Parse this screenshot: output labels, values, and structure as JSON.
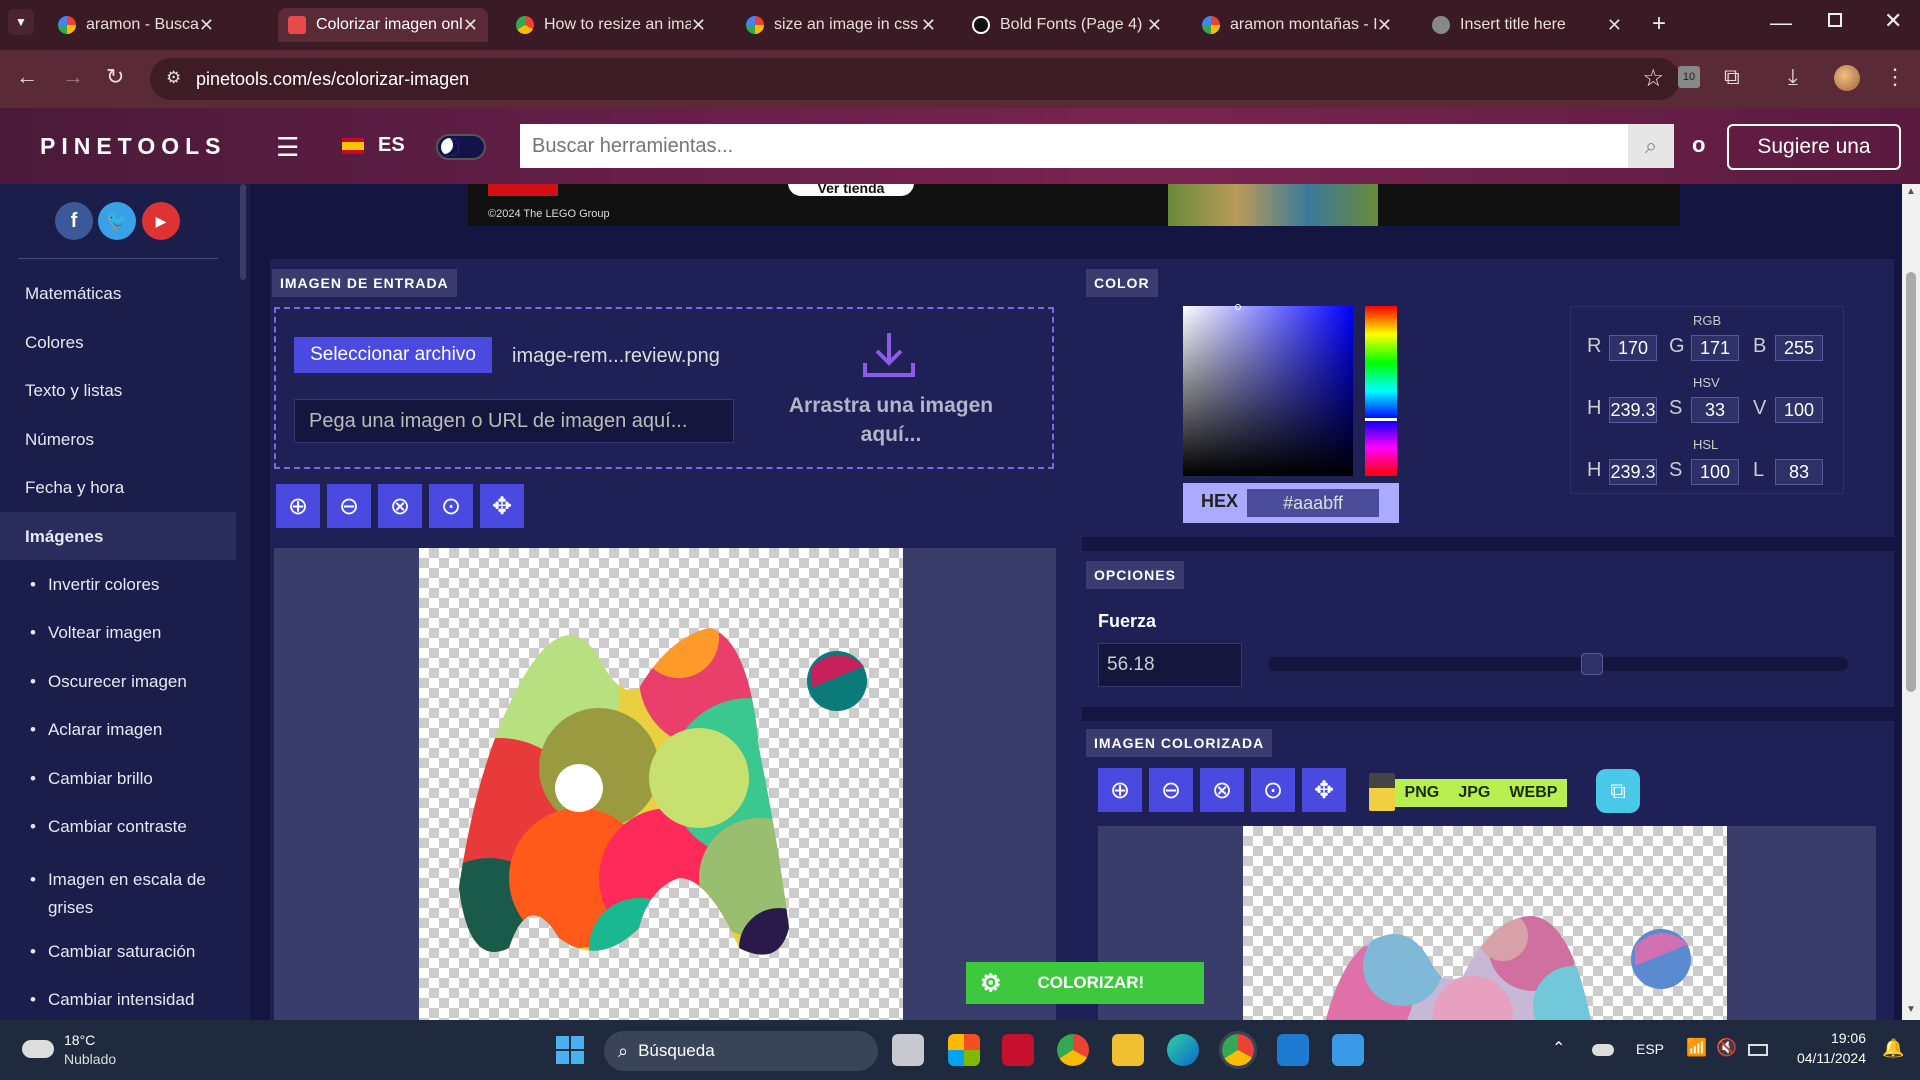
{
  "tabs": [
    {
      "title": "aramon - Buscar con",
      "favicon": "google-icon",
      "active": false
    },
    {
      "title": "Colorizar imagen onli",
      "favicon": "pinetools-icon",
      "active": true
    },
    {
      "title": "How to resize an ima",
      "favicon": "chrome-icon",
      "active": false
    },
    {
      "title": "size an image in css -",
      "favicon": "google-icon",
      "active": false
    },
    {
      "title": "Bold Fonts (Page 4) |",
      "favicon": "bird-icon",
      "active": false
    },
    {
      "title": "aramon montañas - I",
      "favicon": "google-icon",
      "active": false
    },
    {
      "title": "Insert title here",
      "favicon": "globe-icon",
      "active": false
    }
  ],
  "url": "pinetools.com/es/colorizar-imagen",
  "extension_badge": "10",
  "site": {
    "logo": "PINETOOLS",
    "lang": "ES",
    "search_placeholder": "Buscar herramientas...",
    "letter": "o",
    "suggest_label": "Sugiere una"
  },
  "ad": {
    "copyright": "©2024 The LEGO Group",
    "cta": "Ver tienda"
  },
  "sidebar": {
    "categories": [
      "Matemáticas",
      "Colores",
      "Texto y listas",
      "Números",
      "Fecha y hora",
      "Imágenes"
    ],
    "active": "Imágenes",
    "subitems": [
      "Invertir colores",
      "Voltear imagen",
      "Oscurecer imagen",
      "Aclarar imagen",
      "Cambiar brillo",
      "Cambiar contraste",
      "Imagen en escala de grises",
      "Cambiar saturación",
      "Cambiar intensidad"
    ]
  },
  "input_panel": {
    "title": "IMAGEN DE ENTRADA",
    "select_file": "Seleccionar archivo",
    "file_name": "image-rem...review.png",
    "url_placeholder": "Pega una imagen o URL de imagen aquí...",
    "drop_text_1": "Arrastra una imagen",
    "drop_text_2": "aquí..."
  },
  "color_panel": {
    "title": "COLOR",
    "hex_label": "HEX",
    "hex_value": "#aaabff",
    "rgb_label": "RGB",
    "hsv_label": "HSV",
    "hsl_label": "HSL",
    "rgb": {
      "r": "170",
      "g": "171",
      "b": "255"
    },
    "hsv": {
      "h": "239.3",
      "s": "33",
      "v": "100"
    },
    "hsl": {
      "h": "239.3",
      "s": "100",
      "l": "83"
    },
    "letters": {
      "r": "R",
      "g": "G",
      "b": "B",
      "h": "H",
      "s": "S",
      "v": "V",
      "l": "L"
    }
  },
  "options_panel": {
    "title": "OPCIONES",
    "strength_label": "Fuerza",
    "strength_value": "56.18",
    "slider_fraction": 0.5618
  },
  "colorized_panel": {
    "title": "IMAGEN COLORIZADA",
    "formats": [
      "PNG",
      "JPG",
      "WEBP"
    ]
  },
  "colorize_button": "COLORIZAR!",
  "taskbar": {
    "weather_temp": "18°C",
    "weather_desc": "Nublado",
    "search_label": "Búsqueda",
    "lang": "ESP",
    "time": "19:06",
    "date": "04/11/2024"
  },
  "colors": {
    "accent_blue": "#4a4ae0",
    "green_button": "#3ec83e",
    "format_bar": "#b8f050",
    "hex_swatch": "#aaabff"
  }
}
